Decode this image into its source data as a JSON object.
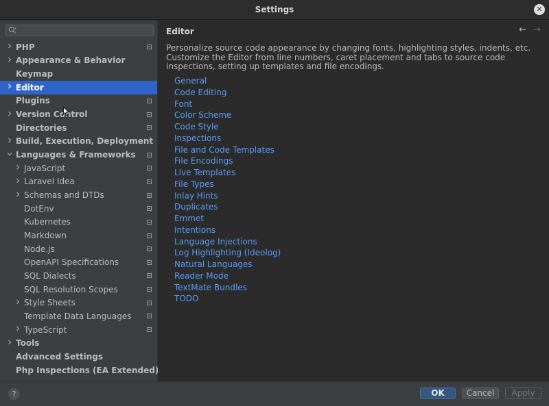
{
  "window": {
    "title": "Settings",
    "close_glyph": "✕"
  },
  "search": {
    "placeholder": "",
    "value": "",
    "icon": "search-icon"
  },
  "tree": [
    {
      "label": "PHP",
      "level": 0,
      "expand": "right",
      "bold": true,
      "page_icon": true
    },
    {
      "label": "Appearance & Behavior",
      "level": 0,
      "expand": "right",
      "bold": true,
      "page_icon": false
    },
    {
      "label": "Keymap",
      "level": 0,
      "expand": "",
      "bold": true,
      "page_icon": false
    },
    {
      "label": "Editor",
      "level": 0,
      "expand": "right",
      "bold": true,
      "page_icon": false,
      "selected": true
    },
    {
      "label": "Plugins",
      "level": 0,
      "expand": "",
      "bold": true,
      "page_icon": true
    },
    {
      "label": "Version Control",
      "level": 0,
      "expand": "right",
      "bold": true,
      "page_icon": true
    },
    {
      "label": "Directories",
      "level": 0,
      "expand": "",
      "bold": true,
      "page_icon": true
    },
    {
      "label": "Build, Execution, Deployment",
      "level": 0,
      "expand": "right",
      "bold": true,
      "page_icon": false
    },
    {
      "label": "Languages & Frameworks",
      "level": 0,
      "expand": "down",
      "bold": true,
      "page_icon": true
    },
    {
      "label": "JavaScript",
      "level": 1,
      "expand": "right",
      "bold": false,
      "page_icon": true
    },
    {
      "label": "Laravel Idea",
      "level": 1,
      "expand": "right",
      "bold": false,
      "page_icon": true
    },
    {
      "label": "Schemas and DTDs",
      "level": 1,
      "expand": "right",
      "bold": false,
      "page_icon": true
    },
    {
      "label": "DotEnv",
      "level": 1,
      "expand": "",
      "bold": false,
      "page_icon": true
    },
    {
      "label": "Kubernetes",
      "level": 1,
      "expand": "",
      "bold": false,
      "page_icon": true
    },
    {
      "label": "Markdown",
      "level": 1,
      "expand": "",
      "bold": false,
      "page_icon": true
    },
    {
      "label": "Node.js",
      "level": 1,
      "expand": "",
      "bold": false,
      "page_icon": true
    },
    {
      "label": "OpenAPI Specifications",
      "level": 1,
      "expand": "",
      "bold": false,
      "page_icon": true
    },
    {
      "label": "SQL Dialects",
      "level": 1,
      "expand": "",
      "bold": false,
      "page_icon": true
    },
    {
      "label": "SQL Resolution Scopes",
      "level": 1,
      "expand": "",
      "bold": false,
      "page_icon": true
    },
    {
      "label": "Style Sheets",
      "level": 1,
      "expand": "right",
      "bold": false,
      "page_icon": true
    },
    {
      "label": "Template Data Languages",
      "level": 1,
      "expand": "",
      "bold": false,
      "page_icon": true
    },
    {
      "label": "TypeScript",
      "level": 1,
      "expand": "right",
      "bold": false,
      "page_icon": true
    },
    {
      "label": "Tools",
      "level": 0,
      "expand": "right",
      "bold": true,
      "page_icon": false
    },
    {
      "label": "Advanced Settings",
      "level": 0,
      "expand": "",
      "bold": true,
      "page_icon": false
    },
    {
      "label": "Php Inspections (EA Extended)",
      "level": 0,
      "expand": "",
      "bold": true,
      "page_icon": false
    }
  ],
  "content": {
    "heading": "Editor",
    "back_glyph": "←",
    "forward_glyph": "→",
    "description": "Personalize source code appearance by changing fonts, highlighting styles, indents, etc. Customize the Editor from line numbers, caret placement and tabs to source code inspections, setting up templates and file encodings.",
    "links": [
      "General",
      "Code Editing",
      "Font",
      "Color Scheme",
      "Code Style",
      "Inspections",
      "File and Code Templates",
      "File Encodings",
      "Live Templates",
      "File Types",
      "Inlay Hints",
      "Duplicates",
      "Emmet",
      "Intentions",
      "Language Injections",
      "Log Highlighting (Ideolog)",
      "Natural Languages",
      "Reader Mode",
      "TextMate Bundles",
      "TODO"
    ]
  },
  "footer": {
    "help_glyph": "?",
    "ok": "OK",
    "cancel": "Cancel",
    "apply": "Apply"
  },
  "colors": {
    "selection": "#2f65ca",
    "link": "#589df6",
    "sidebar_bg": "#3c3f41",
    "content_bg": "#2b2b2b"
  }
}
